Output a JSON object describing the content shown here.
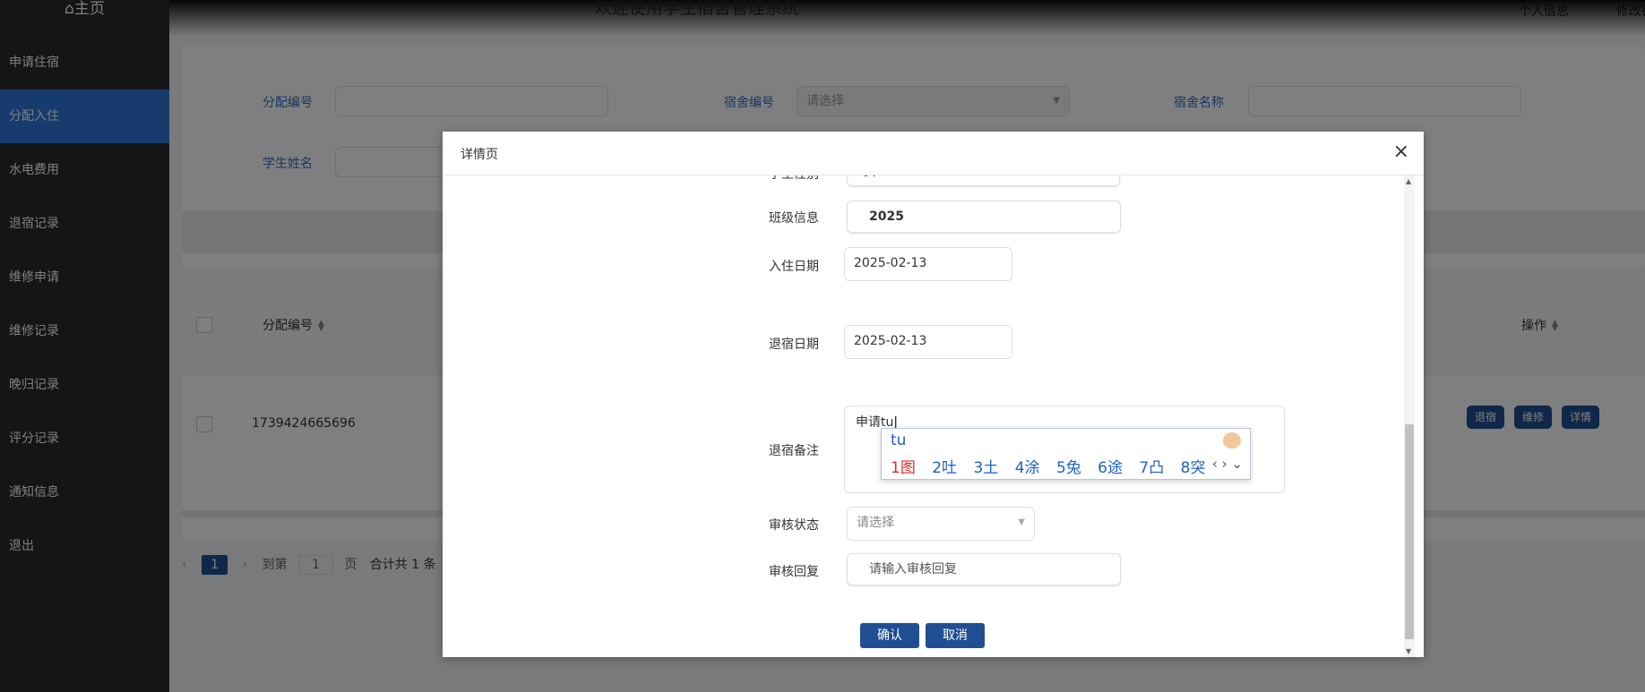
{
  "sidebar": {
    "home_label": "⌂主页",
    "items": [
      {
        "label": "申请住宿"
      },
      {
        "label": "分配入住"
      },
      {
        "label": "水电费用"
      },
      {
        "label": "退宿记录"
      },
      {
        "label": "维修申请"
      },
      {
        "label": "维修记录"
      },
      {
        "label": "晚归记录"
      },
      {
        "label": "评分记录"
      },
      {
        "label": "通知信息"
      },
      {
        "label": "退出"
      }
    ],
    "active_index": 1
  },
  "header": {
    "title": "欢迎使用学生宿舍管理系统",
    "profile_link": "个人信息",
    "change_password_link": "修改密"
  },
  "search": {
    "alloc_no_label": "分配编号",
    "dorm_no_label": "宿舍编号",
    "dorm_no_placeholder": "请选择",
    "dorm_name_label": "宿舍名称",
    "student_name_label": "学生姓名"
  },
  "table": {
    "col_alloc_no": "分配编号",
    "col_ops": "操作",
    "row_alloc_no": "1739424665696",
    "btn_checkout": "退宿",
    "btn_repair": "维修",
    "btn_detail": "详情"
  },
  "pager": {
    "current_page": "1",
    "goto_label": "到第",
    "goto_value": "1",
    "page_label": "页",
    "total_label": "合计共 1 条"
  },
  "dialog": {
    "title": "详情页",
    "close_icon": "×",
    "gender_label": "学生性别",
    "gender_value": "女",
    "class_label": "班级信息",
    "class_value": "2025",
    "checkin_label": "入住日期",
    "checkin_value": "2025-02-13",
    "checkout_label": "退宿日期",
    "checkout_value": "2025-02-13",
    "remark_label": "退宿备注",
    "remark_value": "申请tu",
    "audit_status_label": "审核状态",
    "audit_status_placeholder": "请选择",
    "audit_reply_label": "审核回复",
    "audit_reply_placeholder": "请输入审核回复",
    "confirm_button": "确认",
    "cancel_button": "取消"
  },
  "ime": {
    "pinyin": "tu",
    "candidates": [
      "1图",
      "2吐",
      "3土",
      "4涂",
      "5兔",
      "6途",
      "7凸",
      "8突"
    ],
    "nav": "‹ › ⌄"
  },
  "colors": {
    "sidebar_bg": "#2a2a2a",
    "active_menu": "#2e77d9",
    "primary_button": "#1f4e93",
    "label_blue": "#2f6fc6",
    "overlay": "rgba(0,0,0,0.5)"
  }
}
